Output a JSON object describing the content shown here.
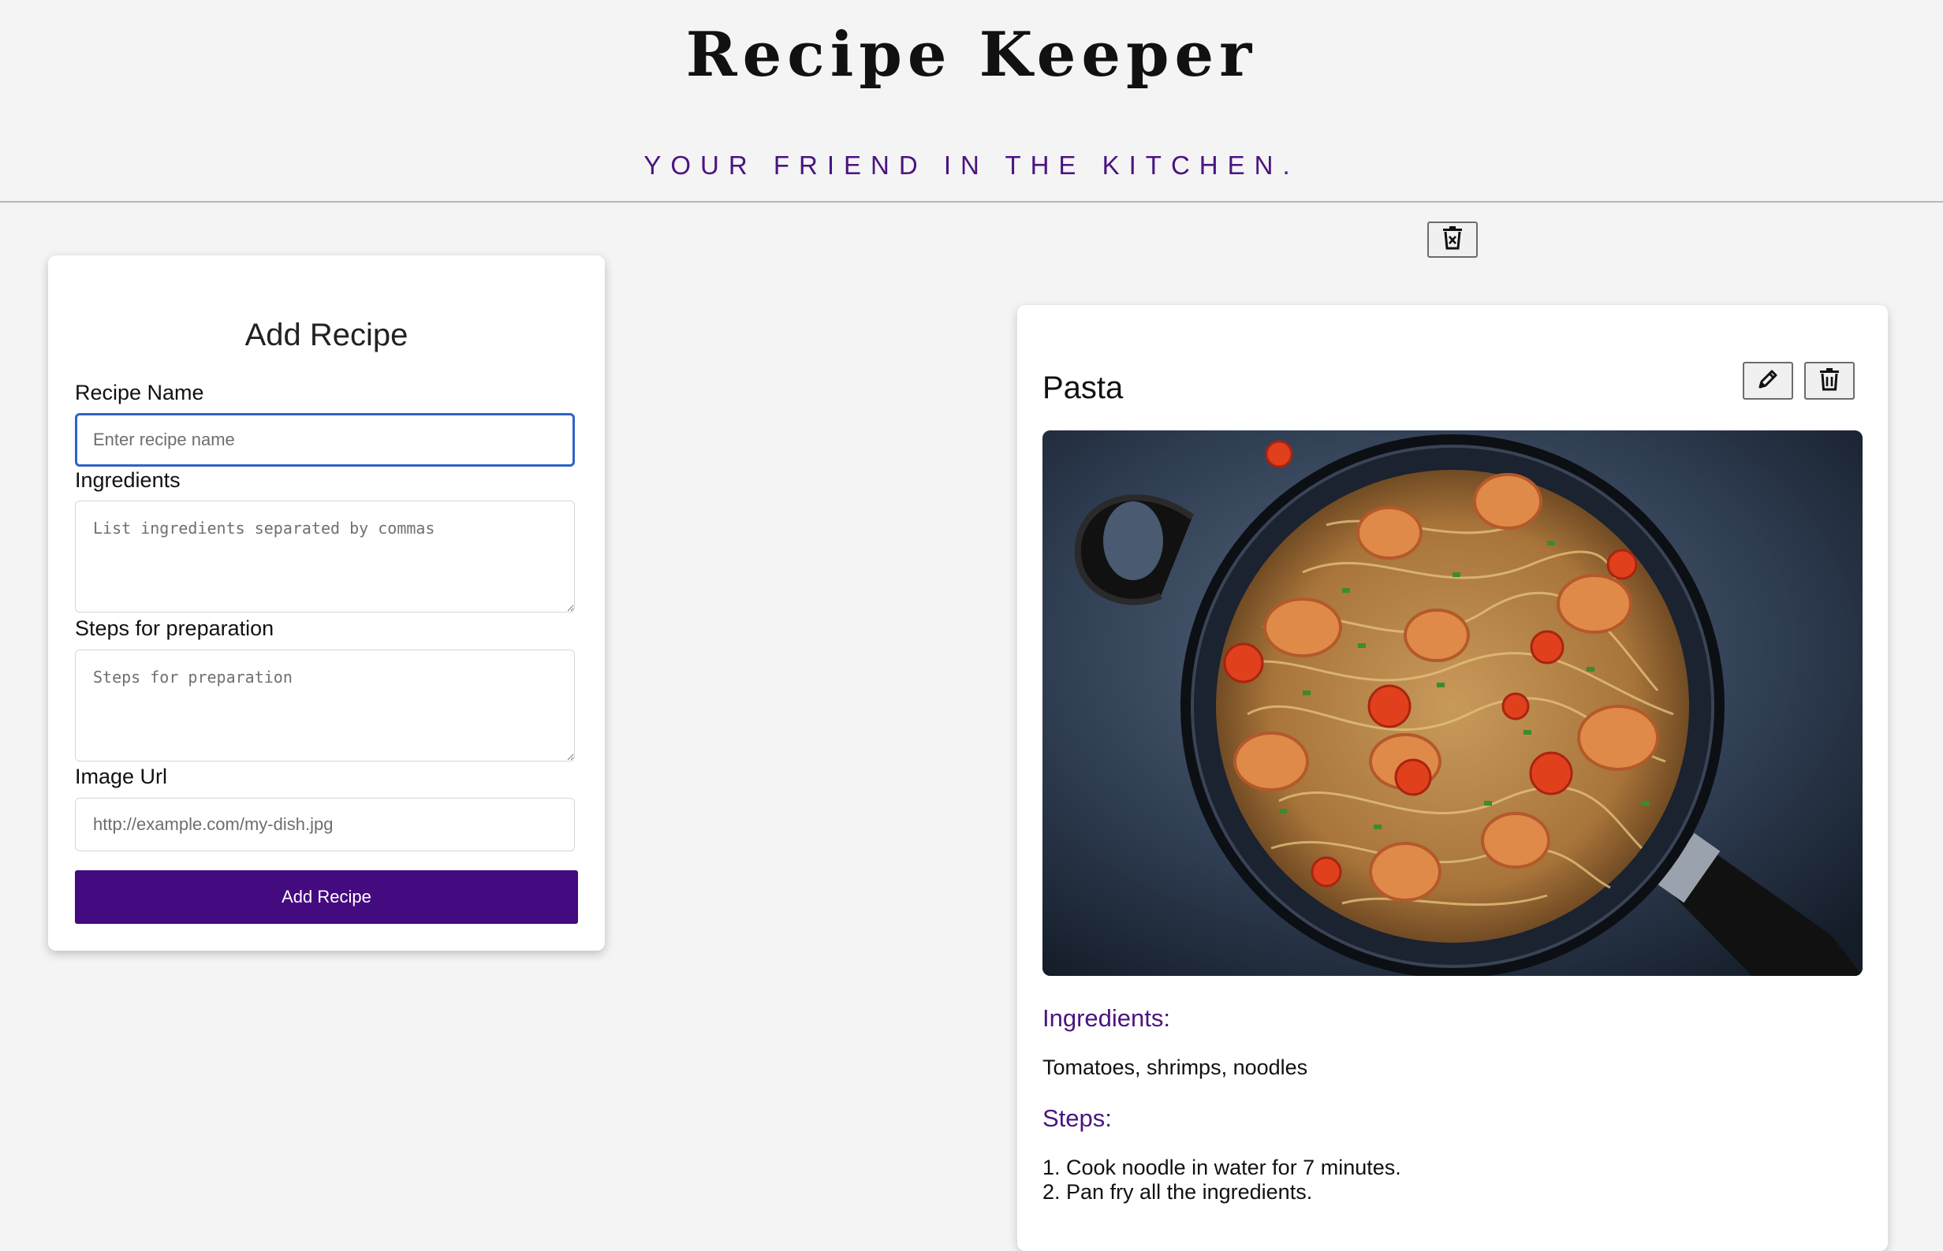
{
  "header": {
    "title": "Recipe Keeper",
    "tagline": "YOUR FRIEND IN THE KITCHEN."
  },
  "toolbar": {
    "clear_all_icon": "trash-x-icon"
  },
  "form": {
    "title": "Add Recipe",
    "fields": {
      "name": {
        "label": "Recipe Name",
        "placeholder": "Enter recipe name",
        "value": ""
      },
      "ingredients": {
        "label": "Ingredients",
        "placeholder": "List ingredients separated by commas",
        "value": ""
      },
      "steps": {
        "label": "Steps for preparation",
        "placeholder": "Steps for preparation",
        "value": ""
      },
      "image_url": {
        "label": "Image Url",
        "placeholder": "http://example.com/my-dish.jpg",
        "value": ""
      }
    },
    "submit_label": "Add Recipe"
  },
  "recipes": [
    {
      "name": "Pasta",
      "edit_icon": "pencil-icon",
      "delete_icon": "trash-icon",
      "image_description_icon": "pasta-dish-image",
      "ingredients_heading": "Ingredients:",
      "ingredients": "Tomatoes, shrimps, noodles",
      "steps_heading": "Steps:",
      "steps": [
        "1. Cook noodle in water for 7 minutes.",
        "2. Pan fry all the ingredients."
      ]
    }
  ],
  "colors": {
    "accent": "#440a7f",
    "heading_purple": "#4a1480",
    "background": "#f4f4f4",
    "focus_blue": "#2f62c9"
  }
}
